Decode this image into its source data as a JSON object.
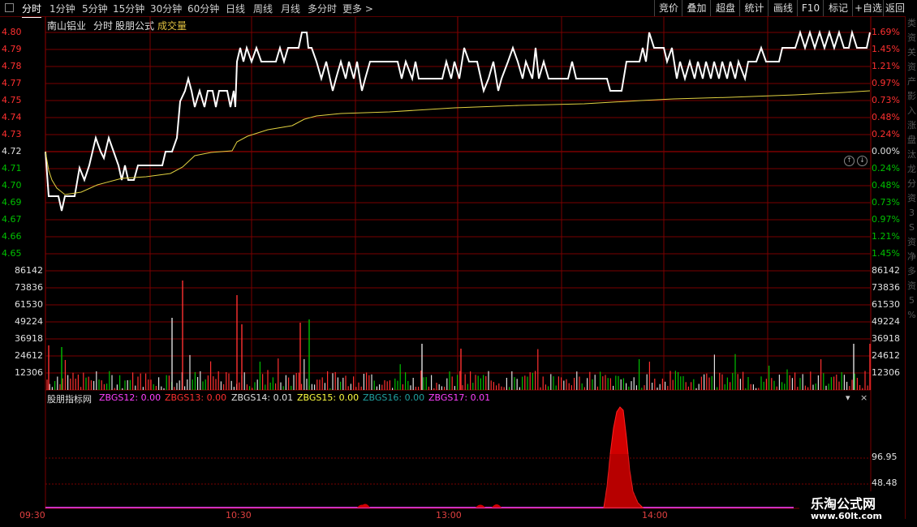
{
  "toolbar": {
    "timeframes": [
      "分时",
      "1分钟",
      "5分钟",
      "15分钟",
      "30分钟",
      "60分钟",
      "日线",
      "周线",
      "月线",
      "多分时",
      "更多 >"
    ],
    "active_index": 0,
    "right_buttons": [
      "竞价",
      "叠加",
      "超盘",
      "统计",
      "画线",
      "F10",
      "标记",
      "+自选",
      "返回"
    ]
  },
  "header": {
    "stock_name": "南山铝业",
    "mode": "分时",
    "formula_name": "股朋公式",
    "volume_label": "成交量"
  },
  "price_axis": {
    "left": [
      "4.80",
      "4.79",
      "4.78",
      "4.77",
      "4.75",
      "4.74",
      "4.73",
      "4.72",
      "4.71",
      "4.70",
      "4.69",
      "4.67",
      "4.66",
      "4.65"
    ],
    "right": [
      "1.69%",
      "1.45%",
      "1.21%",
      "0.97%",
      "0.73%",
      "0.48%",
      "0.24%",
      "0.00%",
      "0.24%",
      "0.48%",
      "0.73%",
      "0.97%",
      "1.21%",
      "1.45%"
    ]
  },
  "volume_axis": [
    "86142",
    "73836",
    "61530",
    "49224",
    "36918",
    "24612",
    "12306"
  ],
  "indicator": {
    "source": "股朋指标网",
    "items": [
      {
        "label": "ZBGS12: 0.00",
        "color": "#ff40ff"
      },
      {
        "label": "ZBGS13: 0.00",
        "color": "#ff3030"
      },
      {
        "label": "ZBGS14: 0.01",
        "color": "#e0e0e0"
      },
      {
        "label": "ZBGS15: 0.00",
        "color": "#ffff40"
      },
      {
        "label": "ZBGS16: 0.00",
        "color": "#20a0a0"
      },
      {
        "label": "ZBGS17: 0.01",
        "color": "#ff40ff"
      }
    ],
    "axis": [
      "96.95",
      "48.48"
    ],
    "dropdown_glyph": "▾",
    "close_glyph": "×"
  },
  "time_axis": [
    "09:30",
    "10:30",
    "13:00",
    "14:00"
  ],
  "watermark": {
    "title": "乐淘公式网",
    "url": "www.60lt.com"
  },
  "side_panel_text": [
    "类",
    "资",
    "关",
    "资",
    "产",
    "影",
    "入",
    "涨",
    "盘",
    "汰",
    "龙",
    "分",
    "资",
    "3",
    "S",
    "资",
    "净",
    "多",
    "资",
    "5",
    "%"
  ],
  "colors": {
    "up": "#ff3030",
    "down": "#00c000",
    "grid": "#7a0000",
    "price_line": "#ffffff",
    "avg_line": "#e0d040"
  }
}
